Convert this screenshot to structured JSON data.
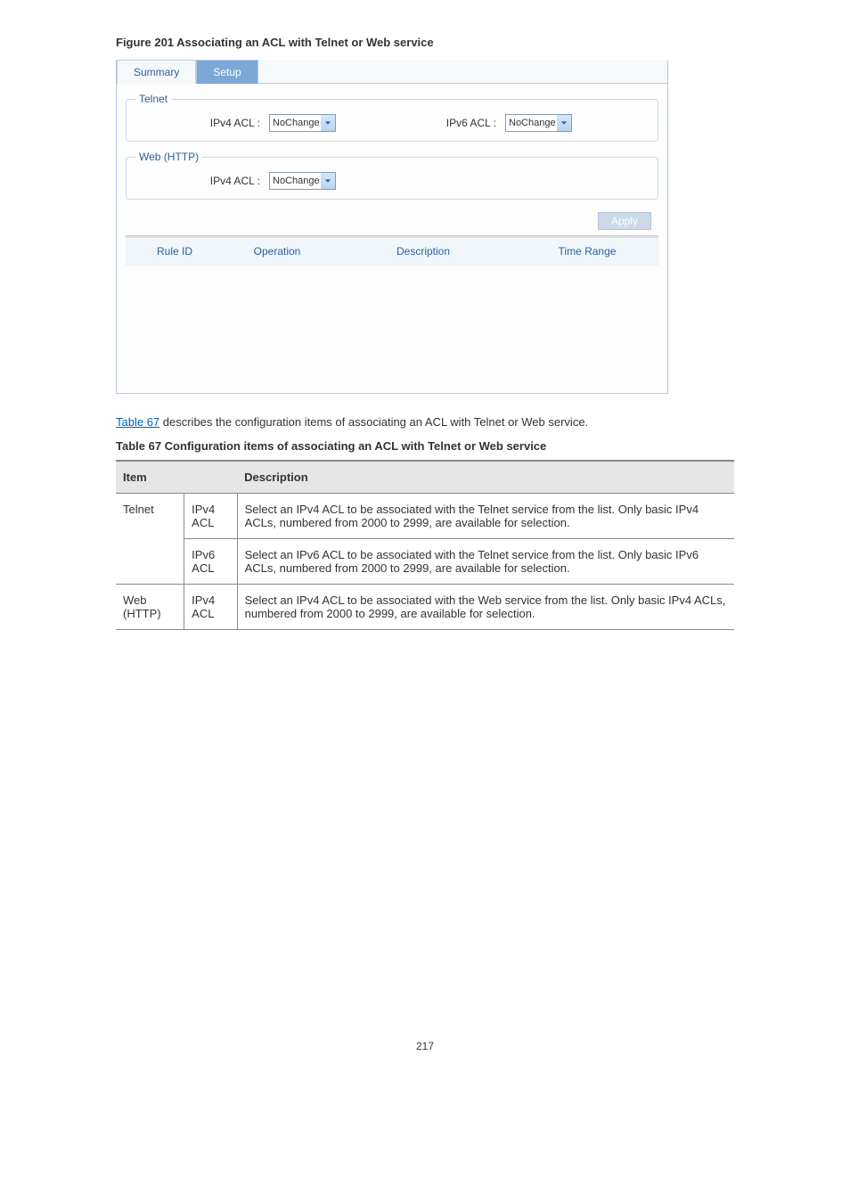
{
  "figure_caption": "Figure 201 Associating an ACL with Telnet or Web service",
  "ui": {
    "tabs": {
      "summary": "Summary",
      "setup": "Setup"
    },
    "telnet": {
      "legend": "Telnet",
      "ipv4_label": "IPv4 ACL :",
      "ipv4_value": "NoChange",
      "ipv6_label": "IPv6 ACL :",
      "ipv6_value": "NoChange"
    },
    "web": {
      "legend": "Web (HTTP)",
      "ipv4_label": "IPv4 ACL :",
      "ipv4_value": "NoChange"
    },
    "apply_label": "Apply",
    "columns": {
      "rule_id": "Rule ID",
      "operation": "Operation",
      "description": "Description",
      "time_range": "Time Range"
    }
  },
  "description": {
    "intro_prefix": "",
    "link_text": "Table 67",
    "intro_suffix": " describes the configuration items of associating an ACL with Telnet or Web service.",
    "table_caption": "Table 67 Configuration items of associating an ACL with Telnet or Web service",
    "headers": {
      "item": "Item",
      "description": "Description"
    },
    "rows": [
      {
        "group": "Telnet",
        "subitem": "IPv4 ACL",
        "group_rowspan": 2,
        "text": "Select an IPv4 ACL to be associated with the Telnet service from the list. Only basic IPv4 ACLs, numbered from 2000 to 2999, are available for selection."
      },
      {
        "subitem": "IPv6 ACL",
        "text": "Select an IPv6 ACL to be associated with the Telnet service from the list. Only basic IPv6 ACLs, numbered from 2000 to 2999, are available for selection."
      },
      {
        "group": "Web (HTTP)",
        "subitem": "IPv4 ACL",
        "group_rowspan": 1,
        "text": "Select an IPv4 ACL to be associated with the Web service from the list. Only basic IPv4 ACLs, numbered from 2000 to 2999, are available for selection."
      }
    ]
  },
  "page_number": "217"
}
